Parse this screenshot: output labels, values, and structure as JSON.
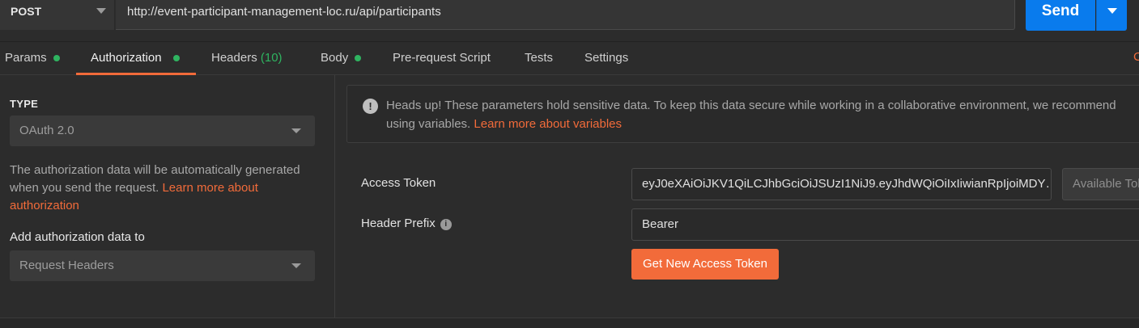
{
  "request": {
    "method": "POST",
    "url": "http://event-participant-management-loc.ru/api/participants",
    "send_label": "Send"
  },
  "tabs": [
    {
      "label": "Params",
      "dot": true
    },
    {
      "label": "Authorization",
      "dot": true,
      "active": true
    },
    {
      "label": "Headers",
      "count": "(10)"
    },
    {
      "label": "Body",
      "dot": true
    },
    {
      "label": "Pre-request Script"
    },
    {
      "label": "Tests"
    },
    {
      "label": "Settings"
    }
  ],
  "tab_overflow": "C",
  "auth": {
    "type_label": "TYPE",
    "type_value": "OAuth 2.0",
    "description": "The authorization data will be automatically generated when you send the request. ",
    "description_link": "Learn more about authorization",
    "add_to_label": "Add authorization data to",
    "add_to_value": "Request Headers"
  },
  "notice": {
    "line1": "Heads up! These parameters hold sensitive data. To keep this data secure while working in a collaborative environment, we recommend",
    "line2": "using variables. ",
    "link": "Learn more about variables"
  },
  "token": {
    "access_token_label": "Access Token",
    "access_token_value": "eyJ0eXAiOiJKV1QiLCJhbGciOiJSUzI1NiJ9.eyJhdWQiOiIxIiwianRpIjoiMDY…",
    "available_tokens": "Available Tokens",
    "header_prefix_label": "Header Prefix",
    "header_prefix_value": "Bearer",
    "get_new_token": "Get New Access Token"
  },
  "colors": {
    "accent": "#f26b3a",
    "send_blue": "#097bed",
    "status_green": "#2fb460"
  }
}
